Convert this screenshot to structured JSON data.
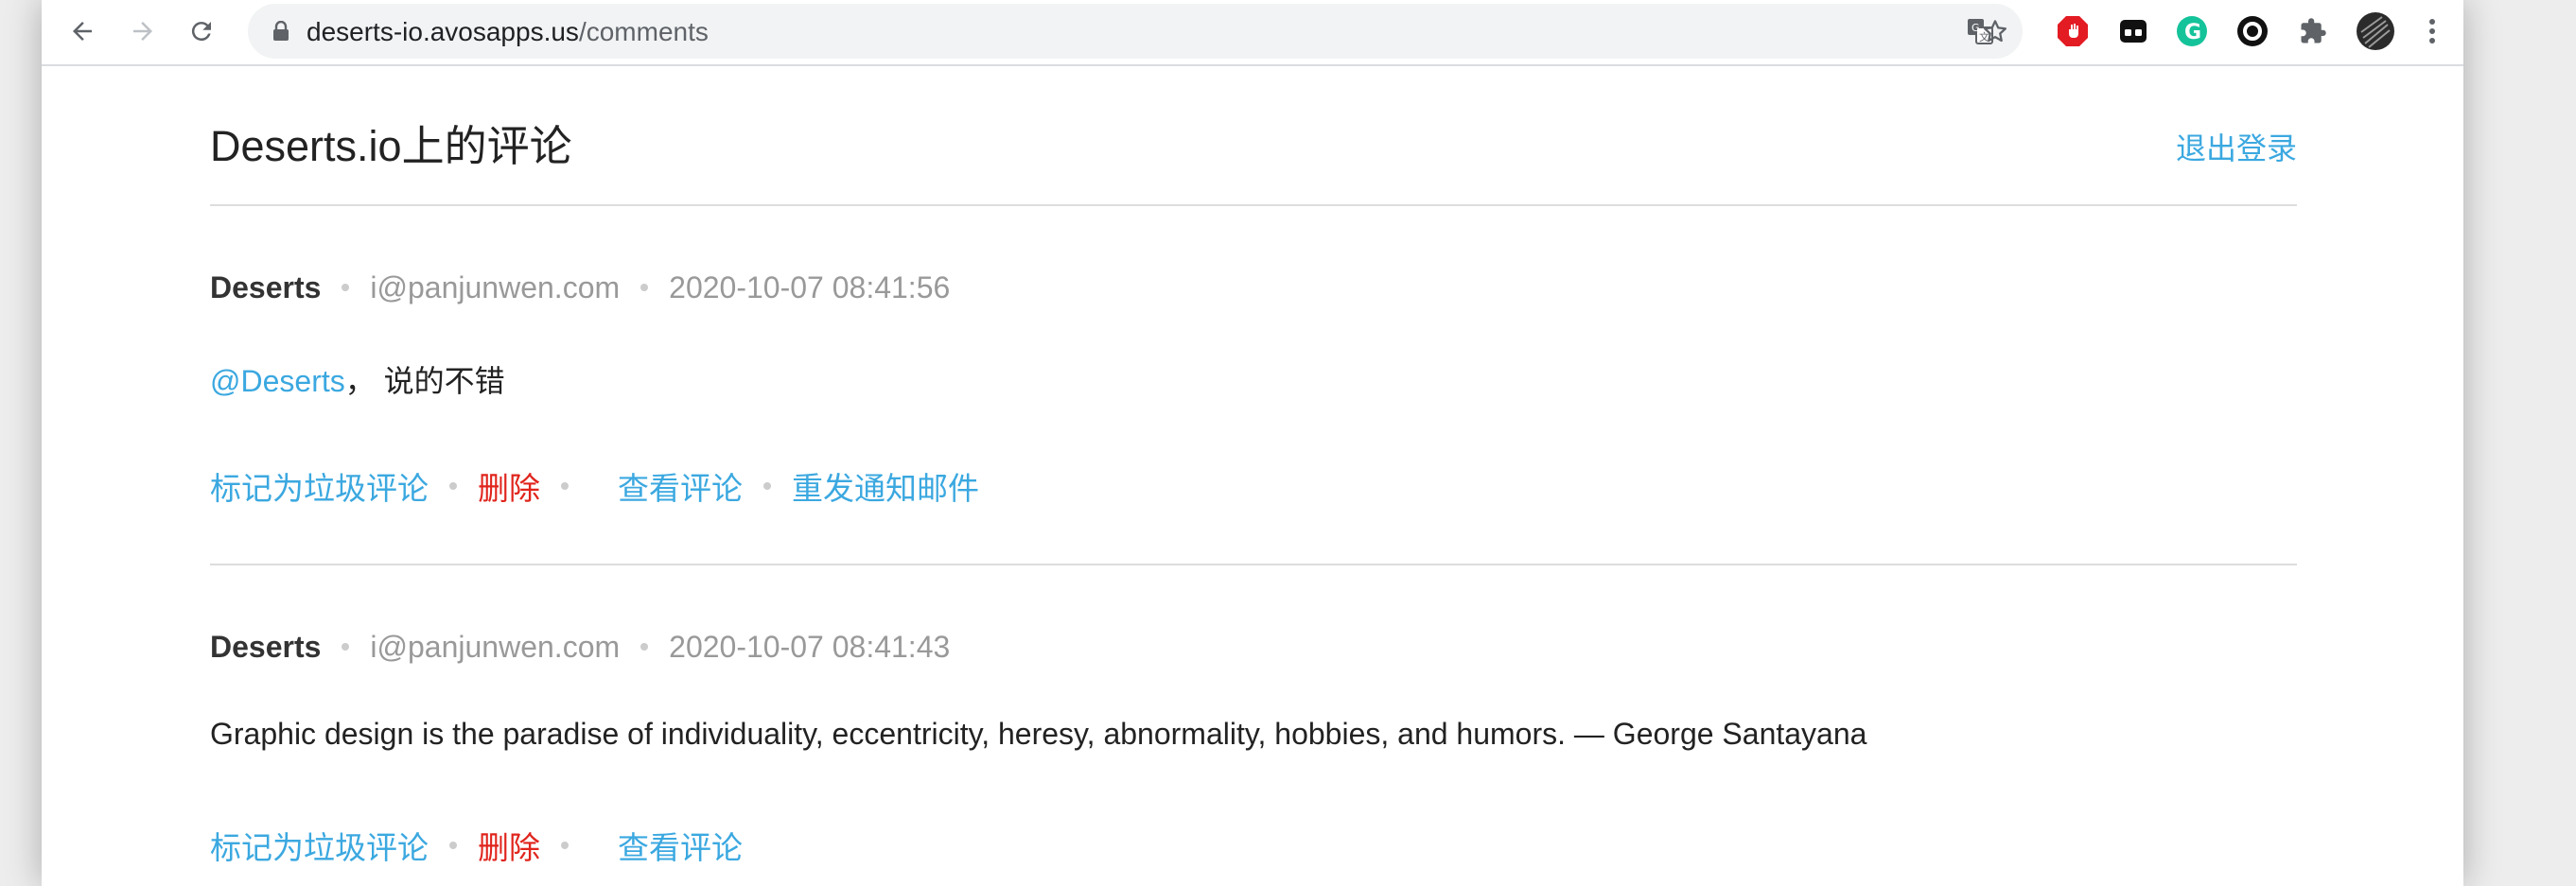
{
  "browser": {
    "url_host": "deserts-io.avosapps.us",
    "url_path": "/comments"
  },
  "page": {
    "title": "Deserts.io上的评论",
    "logout_label": "退出登录"
  },
  "comments": [
    {
      "author": "Deserts",
      "email": "i@panjunwen.com",
      "time": "2020-10-07 08:41:56",
      "mention": "@Deserts",
      "text": "， 说的不错",
      "actions": {
        "spam": "标记为垃圾评论",
        "delete": "删除",
        "view": "查看评论",
        "resend": "重发通知邮件"
      }
    },
    {
      "author": "Deserts",
      "email": "i@panjunwen.com",
      "time": "2020-10-07 08:41:43",
      "text": "Graphic design is the paradise of individuality, eccentricity, heresy, abnormality, hobbies, and humors. — George Santayana",
      "actions": {
        "spam": "标记为垃圾评论",
        "delete": "删除",
        "view": "查看评论"
      }
    }
  ],
  "colors": {
    "link": "#3ba8e0",
    "danger": "#e0241c",
    "muted": "#999999"
  }
}
